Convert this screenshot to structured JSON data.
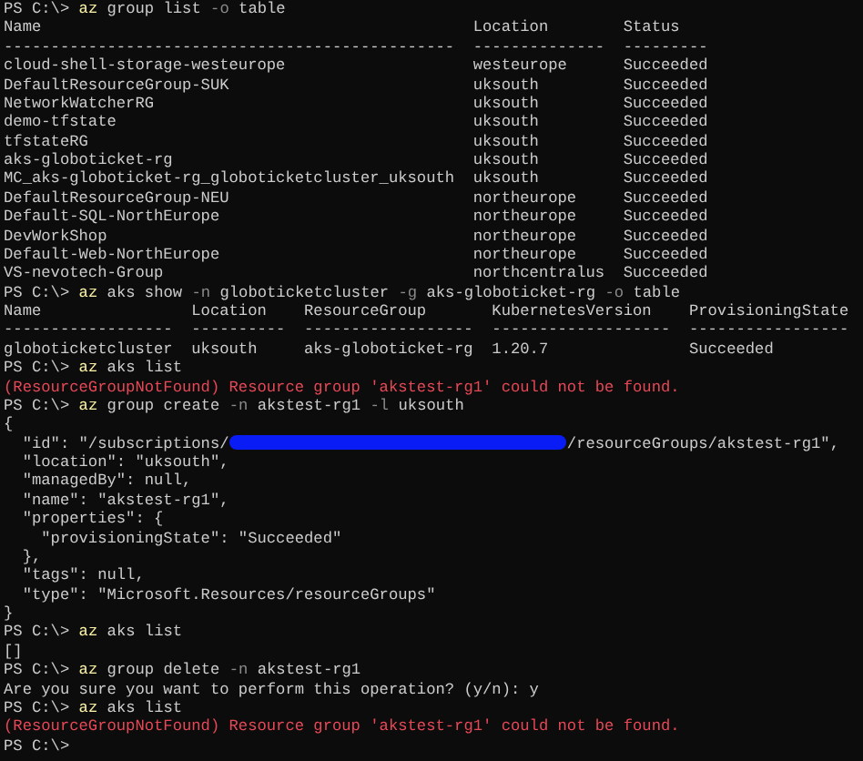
{
  "terminal": {
    "blocks": [
      {
        "kind": "command",
        "segments": [
          {
            "kind": "prompt",
            "text": "PS C:\\>"
          },
          {
            "kind": "exe",
            "text": "az"
          },
          {
            "kind": "arg",
            "text": "group list"
          },
          {
            "kind": "flag",
            "text": "-o"
          },
          {
            "kind": "arg",
            "text": "table"
          }
        ]
      },
      {
        "kind": "table",
        "columns": [
          "Name",
          "Location",
          "Status"
        ],
        "separators": [
          "------------------------------------------------",
          "--------------",
          "---------"
        ],
        "rows": [
          [
            "cloud-shell-storage-westeurope",
            "westeurope",
            "Succeeded"
          ],
          [
            "DefaultResourceGroup-SUK",
            "uksouth",
            "Succeeded"
          ],
          [
            "NetworkWatcherRG",
            "uksouth",
            "Succeeded"
          ],
          [
            "demo-tfstate",
            "uksouth",
            "Succeeded"
          ],
          [
            "tfstateRG",
            "uksouth",
            "Succeeded"
          ],
          [
            "aks-globoticket-rg",
            "uksouth",
            "Succeeded"
          ],
          [
            "MC_aks-globoticket-rg_globoticketcluster_uksouth",
            "uksouth",
            "Succeeded"
          ],
          [
            "DefaultResourceGroup-NEU",
            "northeurope",
            "Succeeded"
          ],
          [
            "Default-SQL-NorthEurope",
            "northeurope",
            "Succeeded"
          ],
          [
            "DevWorkShop",
            "northeurope",
            "Succeeded"
          ],
          [
            "Default-Web-NorthEurope",
            "northeurope",
            "Succeeded"
          ],
          [
            "VS-nevotech-Group",
            "northcentralus",
            "Succeeded"
          ]
        ]
      },
      {
        "kind": "command",
        "segments": [
          {
            "kind": "prompt",
            "text": "PS C:\\>"
          },
          {
            "kind": "exe",
            "text": "az"
          },
          {
            "kind": "arg",
            "text": "aks show"
          },
          {
            "kind": "flag",
            "text": "-n"
          },
          {
            "kind": "arg",
            "text": "globoticketcluster"
          },
          {
            "kind": "flag",
            "text": "-g"
          },
          {
            "kind": "arg",
            "text": "aks-globoticket-rg"
          },
          {
            "kind": "flag",
            "text": "-o"
          },
          {
            "kind": "arg",
            "text": "table"
          }
        ]
      },
      {
        "kind": "table",
        "columns": [
          "Name",
          "Location",
          "ResourceGroup",
          "KubernetesVersion",
          "ProvisioningState"
        ],
        "separators": [
          "------------------",
          "----------",
          "------------------",
          "-------------------",
          "-----------------"
        ],
        "rows": [
          [
            "globoticketcluster",
            "uksouth",
            "aks-globoticket-rg",
            "1.20.7",
            "Succeeded"
          ]
        ]
      },
      {
        "kind": "command",
        "segments": [
          {
            "kind": "prompt",
            "text": "PS C:\\>"
          },
          {
            "kind": "exe",
            "text": "az"
          },
          {
            "kind": "arg",
            "text": "aks list"
          }
        ]
      },
      {
        "kind": "error",
        "text": "(ResourceGroupNotFound) Resource group 'akstest-rg1' could not be found."
      },
      {
        "kind": "command",
        "segments": [
          {
            "kind": "prompt",
            "text": "PS C:\\>"
          },
          {
            "kind": "exe",
            "text": "az"
          },
          {
            "kind": "arg",
            "text": "group create"
          },
          {
            "kind": "flag",
            "text": "-n"
          },
          {
            "kind": "arg",
            "text": "akstest-rg1"
          },
          {
            "kind": "flag",
            "text": "-l"
          },
          {
            "kind": "arg",
            "text": "uksouth"
          }
        ]
      },
      {
        "kind": "json",
        "lines": [
          {
            "text": "{",
            "children": [
              {
                "segments": [
                  {
                    "kind": "text",
                    "text": "\"id\": \"/subscriptions/"
                  },
                  {
                    "kind": "redaction"
                  },
                  {
                    "kind": "text",
                    "text": "/resourceGroups/akstest-rg1\","
                  }
                ]
              },
              {
                "text": "\"location\": \"uksouth\","
              },
              {
                "text": "\"managedBy\": null,"
              },
              {
                "text": "\"name\": \"akstest-rg1\","
              },
              {
                "text": "\"properties\": {",
                "children": [
                  {
                    "text": "\"provisioningState\": \"Succeeded\""
                  }
                ]
              },
              {
                "text": "},"
              },
              {
                "text": "\"tags\": null,"
              },
              {
                "text": "\"type\": \"Microsoft.Resources/resourceGroups\""
              }
            ]
          },
          {
            "text": "}"
          }
        ]
      },
      {
        "kind": "command",
        "segments": [
          {
            "kind": "prompt",
            "text": "PS C:\\>"
          },
          {
            "kind": "exe",
            "text": "az"
          },
          {
            "kind": "arg",
            "text": "aks list"
          }
        ]
      },
      {
        "kind": "output",
        "text": "[]"
      },
      {
        "kind": "command",
        "segments": [
          {
            "kind": "prompt",
            "text": "PS C:\\>"
          },
          {
            "kind": "exe",
            "text": "az"
          },
          {
            "kind": "arg",
            "text": "group delete"
          },
          {
            "kind": "flag",
            "text": "-n"
          },
          {
            "kind": "arg",
            "text": "akstest-rg1"
          }
        ]
      },
      {
        "kind": "output",
        "text": "Are you sure you want to perform this operation? (y/n): y"
      },
      {
        "kind": "command",
        "segments": [
          {
            "kind": "prompt",
            "text": "PS C:\\>"
          },
          {
            "kind": "exe",
            "text": "az"
          },
          {
            "kind": "arg",
            "text": "aks list"
          }
        ]
      },
      {
        "kind": "error",
        "text": "(ResourceGroupNotFound) Resource group 'akstest-rg1' could not be found."
      },
      {
        "kind": "command",
        "segments": [
          {
            "kind": "prompt",
            "text": "PS C:\\>"
          }
        ]
      }
    ]
  }
}
